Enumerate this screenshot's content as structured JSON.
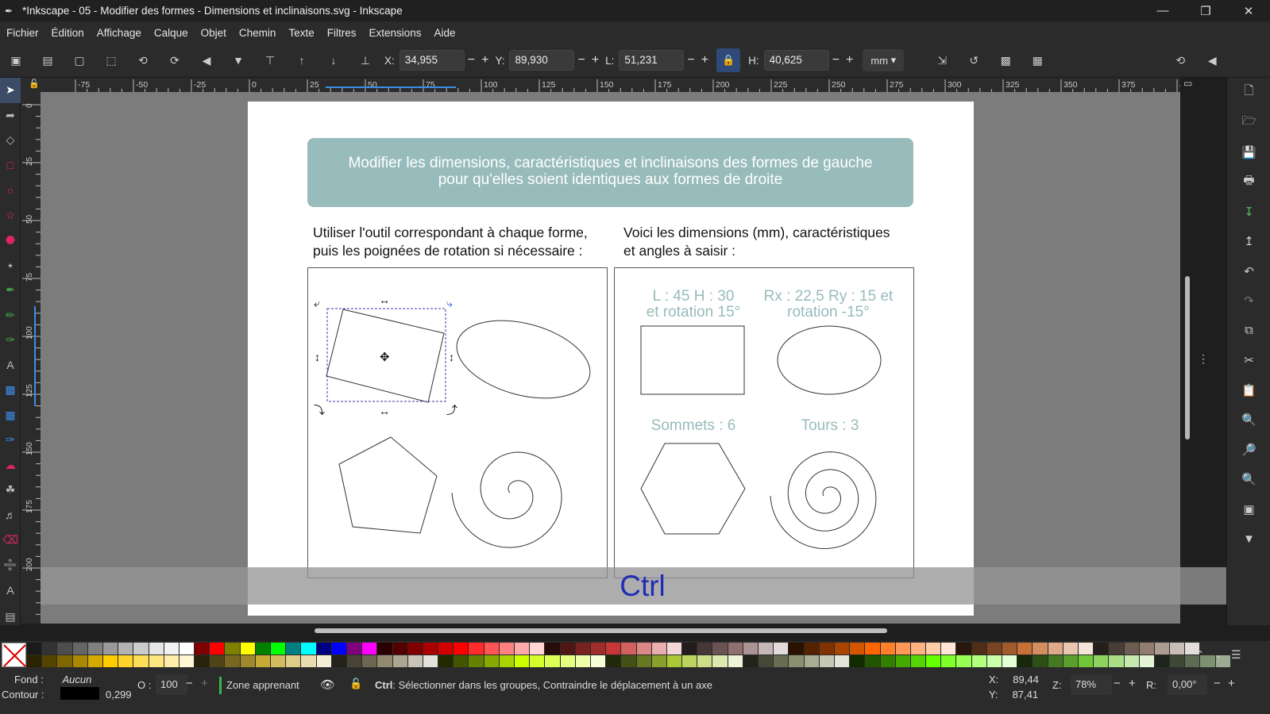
{
  "window": {
    "title": "*Inkscape - 05 - Modifier des formes - Dimensions et inclinaisons.svg - Inkscape"
  },
  "menu": [
    "Fichier",
    "Édition",
    "Affichage",
    "Calque",
    "Objet",
    "Chemin",
    "Texte",
    "Filtres",
    "Extensions",
    "Aide"
  ],
  "toolbar": {
    "x_label": "X:",
    "x_value": "34,955",
    "y_label": "Y:",
    "y_value": "89,930",
    "w_label": "L:",
    "w_value": "51,231",
    "h_label": "H:",
    "h_value": "40,625",
    "unit": "mm"
  },
  "ruler": {
    "h_ticks": [
      "-75",
      "-50",
      "-25",
      "0",
      "25",
      "50",
      "75",
      "100",
      "125",
      "150",
      "175",
      "200",
      "225",
      "250",
      "275",
      "300",
      "325",
      "350",
      "375",
      "40"
    ],
    "v_ticks": [
      "0",
      "25",
      "50",
      "75",
      "100",
      "125",
      "150",
      "175",
      "200"
    ]
  },
  "document": {
    "banner": "Modifier les dimensions, caractéristiques et inclinaisons des formes de gauche pour qu'elles soient identiques aux formes de droite",
    "banner_line1": "Modifier les dimensions, caractéristiques et inclinaisons des formes de gauche",
    "banner_line2": "pour qu'elles soient identiques aux formes de droite",
    "left_instr_1": "Utiliser l'outil correspondant à chaque forme,",
    "left_instr_2": "puis les poignées de rotation si nécessaire :",
    "right_instr_1": "Voici les dimensions (mm), caractéristiques",
    "right_instr_2": "et angles à saisir :",
    "rect_label_1": "L : 45 H : 30",
    "rect_label_2": "et rotation 15°",
    "ellipse_label_1": "Rx : 22,5 Ry : 15 et",
    "ellipse_label_2": "rotation -15°",
    "polygon_label": "Sommets : 6",
    "spiral_label": "Tours : 3",
    "label_color": "#98bbbb"
  },
  "overlay": {
    "key": "Ctrl"
  },
  "status": {
    "fill_label": "Fond :",
    "fill_value": "Aucun",
    "stroke_label": "Contour :",
    "stroke_width": "0,299",
    "opacity_label": "O :",
    "opacity_value": "100",
    "layer": "Zone apprenant",
    "message_bold": "Ctrl",
    "message": ": Sélectionner dans les groupes, Contraindre le déplacement à un axe",
    "cursor_x_label": "X:",
    "cursor_x": "89,44",
    "cursor_y_label": "Y:",
    "cursor_y": "87,41",
    "zoom_label": "Z:",
    "zoom": "78%",
    "rotate_label": "R:",
    "rotate": "0,00°"
  },
  "palette": {
    "row1": [
      "#1a1a1a",
      "#333333",
      "#4d4d4d",
      "#666666",
      "#808080",
      "#999999",
      "#b3b3b3",
      "#cccccc",
      "#e6e6e6",
      "#f2f2f2",
      "#ffffff",
      "#800000",
      "#ff0000",
      "#808000",
      "#ffff00",
      "#008000",
      "#00ff00",
      "#008080",
      "#00ffff",
      "#000080",
      "#0000ff",
      "#800080",
      "#ff00ff",
      "#2b0000",
      "#550000",
      "#800000",
      "#aa0000",
      "#d40000",
      "#ff0000",
      "#ff2a2a",
      "#ff5555",
      "#ff8080",
      "#ffaaaa",
      "#ffd5d5",
      "#280b0b",
      "#501616",
      "#782121",
      "#a02c2c",
      "#c83737",
      "#d35f5f",
      "#de8787",
      "#e9afaf",
      "#f4d7d7",
      "#241c1c",
      "#483737",
      "#6c5353",
      "#916f6f",
      "#ac9393",
      "#c8b7b7",
      "#e3dbdb",
      "#2b1100",
      "#552200",
      "#803300",
      "#aa4400",
      "#d45500",
      "#ff6600",
      "#ff7f2a",
      "#ff9955",
      "#ffb380",
      "#ffccaa",
      "#ffe6d5",
      "#28170b",
      "#502d16",
      "#784421",
      "#a05a2c",
      "#c87137",
      "#d38d5f",
      "#deaa87",
      "#e9c6af",
      "#f4e3d7",
      "#241f1c",
      "#483e37",
      "#6c5d53",
      "#917c6f",
      "#ac9d93",
      "#c8beb7",
      "#e3dedb"
    ],
    "row2": [
      "#2b2200",
      "#554400",
      "#806600",
      "#aa8800",
      "#d4aa00",
      "#ffcc00",
      "#ffd42a",
      "#ffdd55",
      "#ffe680",
      "#ffeeaa",
      "#fff6d5",
      "#28220b",
      "#504416",
      "#786721",
      "#a0892c",
      "#c8ab37",
      "#d3bc5f",
      "#decd87",
      "#e9ddaf",
      "#f4eed7",
      "#24221c",
      "#484537",
      "#6c6753",
      "#918a6f",
      "#aca793",
      "#c8c4b7",
      "#e3e2db",
      "#222b00",
      "#445500",
      "#668000",
      "#88aa00",
      "#aad400",
      "#ccff00",
      "#d4ff2a",
      "#ddff55",
      "#e5ff80",
      "#eeffaa",
      "#f6ffd5",
      "#22280b",
      "#445016",
      "#677821",
      "#89a02c",
      "#abc837",
      "#bcd35f",
      "#cdde87",
      "#dde9af",
      "#eef4d7",
      "#22241c",
      "#454837",
      "#676c53",
      "#8a916f",
      "#a7ac93",
      "#c4c8b7",
      "#e2e3db",
      "#112b00",
      "#225500",
      "#338000",
      "#44aa00",
      "#55d400",
      "#66ff00",
      "#7fff2a",
      "#99ff55",
      "#b3ff80",
      "#ccffaa",
      "#e5ffd5",
      "#17280b",
      "#2d5016",
      "#447821",
      "#5aa02c",
      "#71c837",
      "#8dd35f",
      "#aade87",
      "#c6e9af",
      "#e3f4d7",
      "#1f241c",
      "#3e4837",
      "#5d6c53",
      "#7c916f",
      "#9dac93"
    ]
  }
}
